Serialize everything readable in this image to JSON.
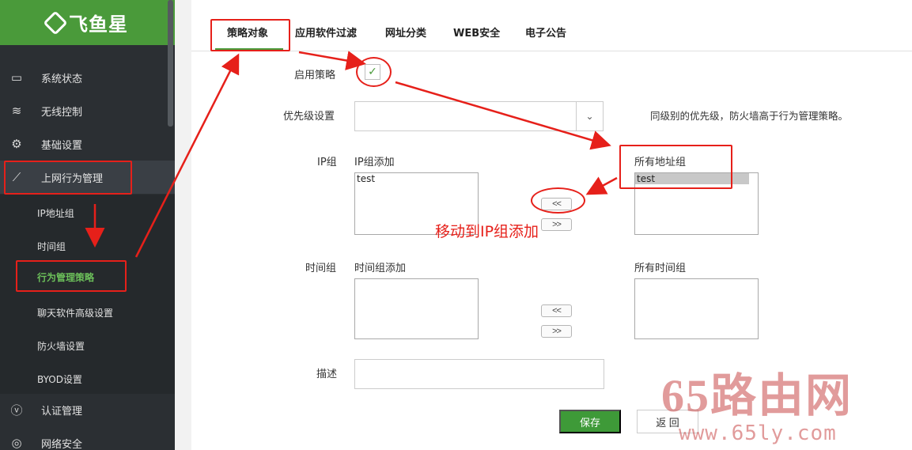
{
  "app": {
    "brand": "飞鱼星"
  },
  "sidebar": {
    "items": [
      {
        "label": "系统状态",
        "icon": "monitor-icon"
      },
      {
        "label": "无线控制",
        "icon": "wifi-icon"
      },
      {
        "label": "基础设置",
        "icon": "gear-icon"
      },
      {
        "label": "上网行为管理",
        "icon": "trend-chart-icon"
      },
      {
        "label": "认证管理",
        "icon": "verify-icon"
      },
      {
        "label": "网络安全",
        "icon": "shield-icon"
      }
    ],
    "subitems": [
      "IP地址组",
      "时间组",
      "行为管理策略",
      "聊天软件高级设置",
      "防火墙设置",
      "BYOD设置"
    ]
  },
  "tabs": [
    "策略对象",
    "应用软件过滤",
    "网址分类",
    "WEB安全",
    "电子公告"
  ],
  "form": {
    "enable_label": "启用策略",
    "priority_label": "优先级设置",
    "priority_hint": "同级别的优先级，防火墙高于行为管理策略。",
    "ipgroup_label": "IP组",
    "ipgroup_add_label": "IP组添加",
    "ipgroup_add_options": [
      "test"
    ],
    "all_address_label": "所有地址组",
    "all_address_options": [
      "test"
    ],
    "timegroup_label": "时间组",
    "timegroup_add_label": "时间组添加",
    "all_time_label": "所有时间组",
    "move_left": "<<",
    "move_right": ">>",
    "desc_label": "描述",
    "save": "保存",
    "back": "返 回"
  },
  "annotation": {
    "text": "移动到IP组添加"
  },
  "watermark": {
    "big": "65路由网",
    "url": "www.65ly.com"
  },
  "colors": {
    "accent": "#4a9a3a",
    "sidebar_bg": "#2b2f33",
    "annotation": "#e6201a"
  }
}
